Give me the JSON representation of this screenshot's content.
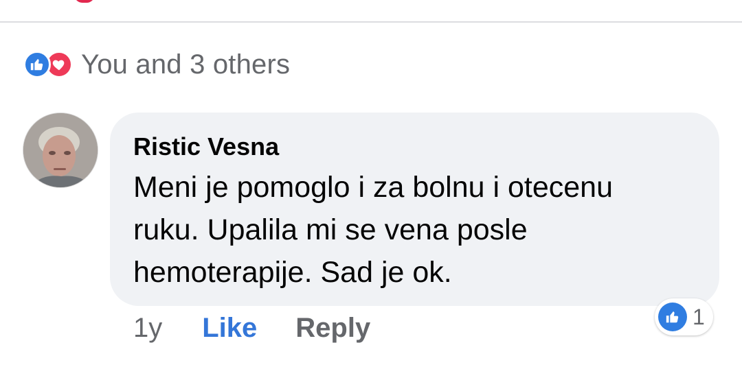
{
  "reactions": {
    "summary_text": "You and 3 others",
    "icons": [
      "like-icon",
      "love-icon"
    ],
    "like_color": "#2f7de1",
    "love_color": "#ee3a58"
  },
  "comment": {
    "author": "Ristic Vesna",
    "text": "Meni je pomoglo i za bolnu i otecenu ruku. Upalila mi se vena posle hemoterapije. Sad je ok.",
    "time": "1y",
    "like_label": "Like",
    "reply_label": "Reply",
    "reaction_count": "1",
    "reaction_icon": "like-icon"
  },
  "colors": {
    "bubble_bg": "#f0f2f5",
    "link_blue": "#3476d8",
    "secondary_text": "#65676b"
  }
}
